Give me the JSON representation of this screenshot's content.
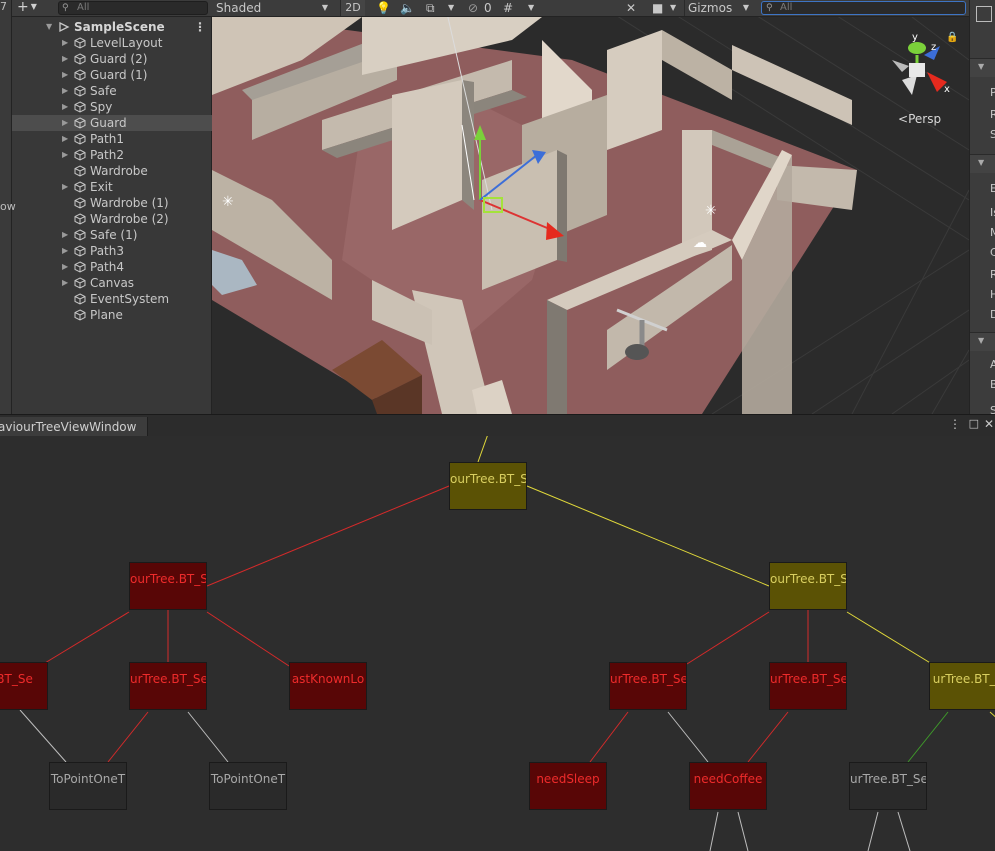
{
  "hierarchy": {
    "edge_label": "ow",
    "edge_number": "7",
    "search_placeholder": "All",
    "scene_name": "SampleScene",
    "items": [
      {
        "label": "LevelLayout",
        "expandable": true,
        "selected": false
      },
      {
        "label": "Guard (2)",
        "expandable": true,
        "selected": false
      },
      {
        "label": "Guard (1)",
        "expandable": true,
        "selected": false
      },
      {
        "label": "Safe",
        "expandable": true,
        "selected": false
      },
      {
        "label": "Spy",
        "expandable": true,
        "selected": false
      },
      {
        "label": "Guard",
        "expandable": true,
        "selected": true
      },
      {
        "label": "Path1",
        "expandable": true,
        "selected": false
      },
      {
        "label": "Path2",
        "expandable": true,
        "selected": false
      },
      {
        "label": "Wardrobe",
        "expandable": false,
        "selected": false
      },
      {
        "label": "Exit",
        "expandable": true,
        "selected": false
      },
      {
        "label": "Wardrobe (1)",
        "expandable": false,
        "selected": false
      },
      {
        "label": "Wardrobe (2)",
        "expandable": false,
        "selected": false
      },
      {
        "label": "Safe (1)",
        "expandable": true,
        "selected": false
      },
      {
        "label": "Path3",
        "expandable": true,
        "selected": false
      },
      {
        "label": "Path4",
        "expandable": true,
        "selected": false
      },
      {
        "label": "Canvas",
        "expandable": true,
        "selected": false
      },
      {
        "label": "EventSystem",
        "expandable": false,
        "selected": false
      },
      {
        "label": "Plane",
        "expandable": false,
        "selected": false
      }
    ]
  },
  "scene": {
    "shading_mode": "Shaded",
    "mode_2d": "2D",
    "hidden_count": "0",
    "gizmos_label": "Gizmos",
    "search_placeholder": "All",
    "projection_label": "Persp",
    "axis_y": "y",
    "axis_z": "z",
    "axis_x": "x"
  },
  "inspector": {
    "letters": [
      "P",
      "R",
      "S",
      "E",
      "Is",
      "M",
      "C",
      "R",
      "H",
      "D",
      "A",
      "B",
      "S"
    ]
  },
  "bt_window": {
    "tab_title": "aviourTreeViewWindow",
    "nodes": [
      {
        "label": "ourTree.BT_S",
        "color": "yellow"
      },
      {
        "label": "ourTree.BT_S",
        "color": "red"
      },
      {
        "label": "ourTree.BT_S",
        "color": "yellow"
      },
      {
        "label": "e.BT_Se",
        "color": "red"
      },
      {
        "label": "urTree.BT_Se",
        "color": "red"
      },
      {
        "label": "astKnownLo",
        "color": "red"
      },
      {
        "label": "urTree.BT_Se",
        "color": "red"
      },
      {
        "label": "urTree.BT_Se",
        "color": "red"
      },
      {
        "label": "urTree.BT_S",
        "color": "yellow"
      },
      {
        "label": "ToPointOneT",
        "color": "grey"
      },
      {
        "label": "ToPointOneT",
        "color": "grey"
      },
      {
        "label": "needSleep",
        "color": "red"
      },
      {
        "label": "needCoffee",
        "color": "red"
      },
      {
        "label": "urTree.BT_Se",
        "color": "grey"
      }
    ],
    "colors": {
      "yellow_node": "#5b5205",
      "red_node": "#580606",
      "grey_node": "#2a2a2a",
      "red_edge": "#d42a2a",
      "yellow_edge": "#e0d83a",
      "grey_edge": "#bdbdbd",
      "green_edge": "#3f9a2a"
    }
  }
}
